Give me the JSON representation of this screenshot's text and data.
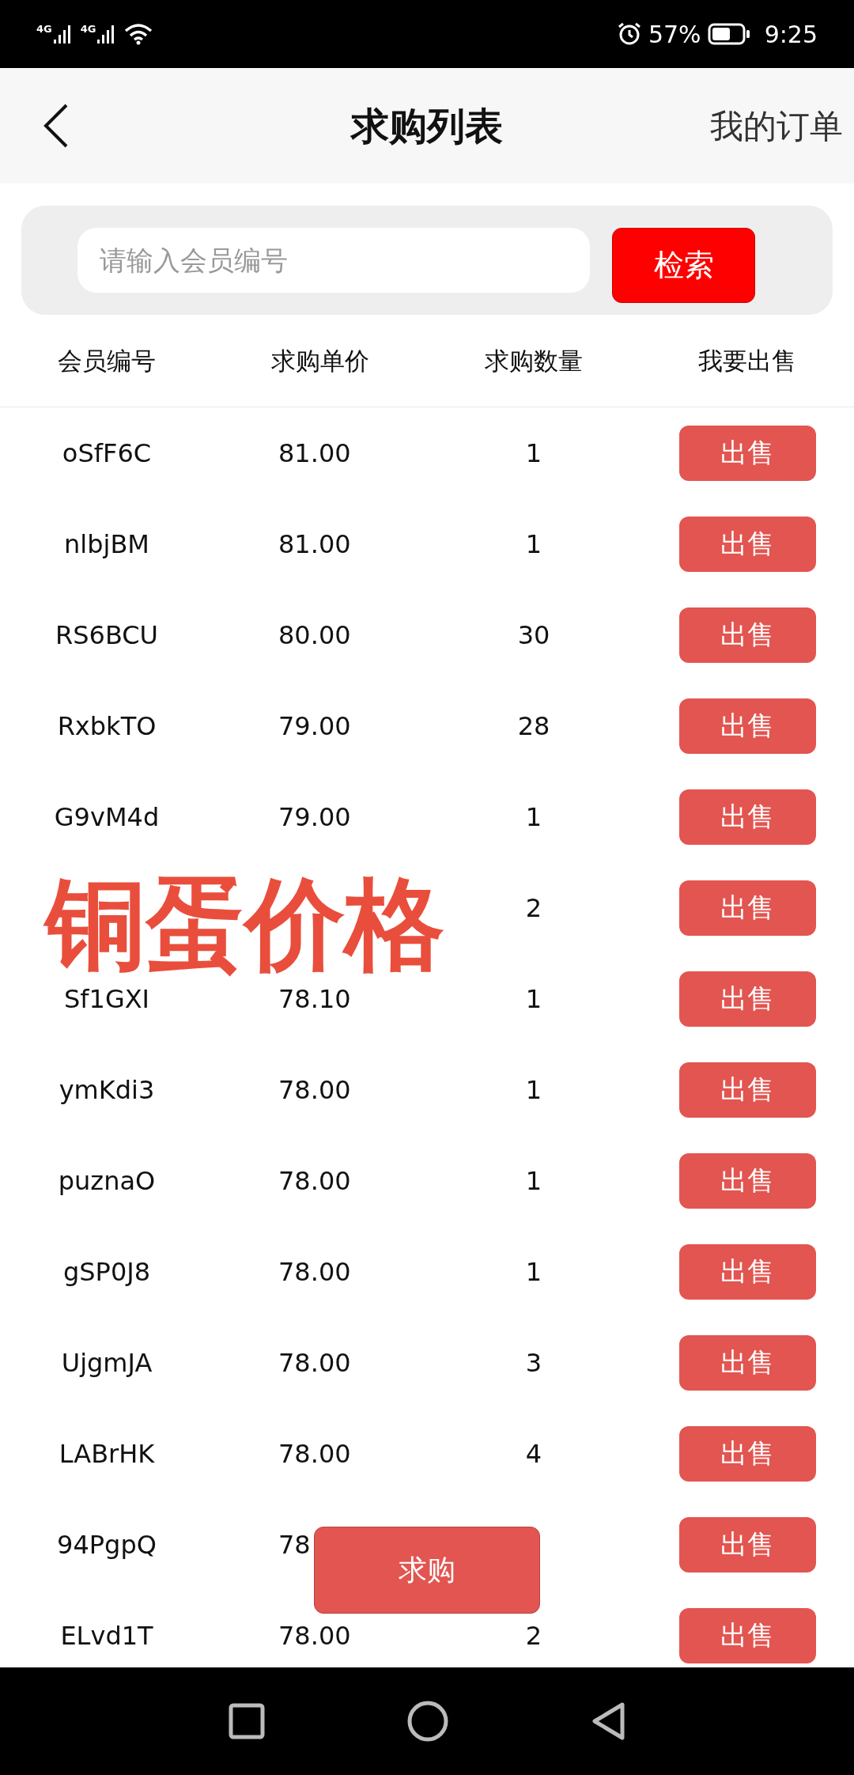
{
  "status_bar": {
    "networks": [
      "4G",
      "4G"
    ],
    "battery_text": "57%",
    "time": "9:25"
  },
  "header": {
    "title": "求购列表",
    "action": "我的订单"
  },
  "search": {
    "placeholder": "请输入会员编号",
    "button": "检索"
  },
  "table": {
    "columns": [
      "会员编号",
      "求购单价",
      "求购数量",
      "我要出售"
    ],
    "rows": [
      {
        "member": "oSfF6C",
        "price": "81.00",
        "quantity": "1",
        "action": "出售"
      },
      {
        "member": "nlbjBM",
        "price": "81.00",
        "quantity": "1",
        "action": "出售"
      },
      {
        "member": "RS6BCU",
        "price": "80.00",
        "quantity": "30",
        "action": "出售"
      },
      {
        "member": "RxbkTO",
        "price": "79.00",
        "quantity": "28",
        "action": "出售"
      },
      {
        "member": "G9vM4d",
        "price": "79.00",
        "quantity": "1",
        "action": "出售"
      },
      {
        "quantity": "2",
        "action": "出售"
      },
      {
        "member": "Sf1GXI",
        "price": "78.10",
        "quantity": "1",
        "action": "出售"
      },
      {
        "member": "ymKdi3",
        "price": "78.00",
        "quantity": "1",
        "action": "出售"
      },
      {
        "member": "puznaO",
        "price": "78.00",
        "quantity": "1",
        "action": "出售"
      },
      {
        "member": "gSP0J8",
        "price": "78.00",
        "quantity": "1",
        "action": "出售"
      },
      {
        "member": "UjgmJA",
        "price": "78.00",
        "quantity": "3",
        "action": "出售"
      },
      {
        "member": "LABrHK",
        "price": "78.00",
        "quantity": "4",
        "action": "出售"
      },
      {
        "member": "94PgpQ",
        "price": "78",
        "action": "出售"
      },
      {
        "member": "ELvd1T",
        "price": "78.00",
        "quantity": "2",
        "action": "出售"
      }
    ]
  },
  "overlay_caption": "铜蛋价格",
  "floating_button": "求购"
}
